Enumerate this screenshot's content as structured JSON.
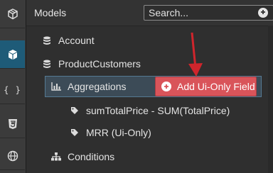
{
  "rail": {
    "items": [
      {
        "icon": "cube-outline-icon",
        "active": false
      },
      {
        "icon": "cube-icon",
        "active": true
      },
      {
        "icon": "braces-icon",
        "active": false,
        "glyph": "{ }"
      },
      {
        "icon": "css3-icon",
        "active": false
      },
      {
        "icon": "globe-icon",
        "active": false
      }
    ]
  },
  "header": {
    "title": "Models",
    "search_placeholder": "Search..."
  },
  "tree": {
    "account": "Account",
    "product_customers": "ProductCustomers",
    "aggregations": "Aggregations",
    "sum_total_price": "sumTotalPrice - SUM(TotalPrice)",
    "mrr": "MRR (Ui-Only)",
    "conditions": "Conditions"
  },
  "actions": {
    "add_ui_only_field": "Add Ui-Only Field"
  },
  "colors": {
    "accent_active": "#1e5b78",
    "button_red": "#d9545a",
    "arrow_red": "#d0252c",
    "selection": "#3c4b57"
  }
}
